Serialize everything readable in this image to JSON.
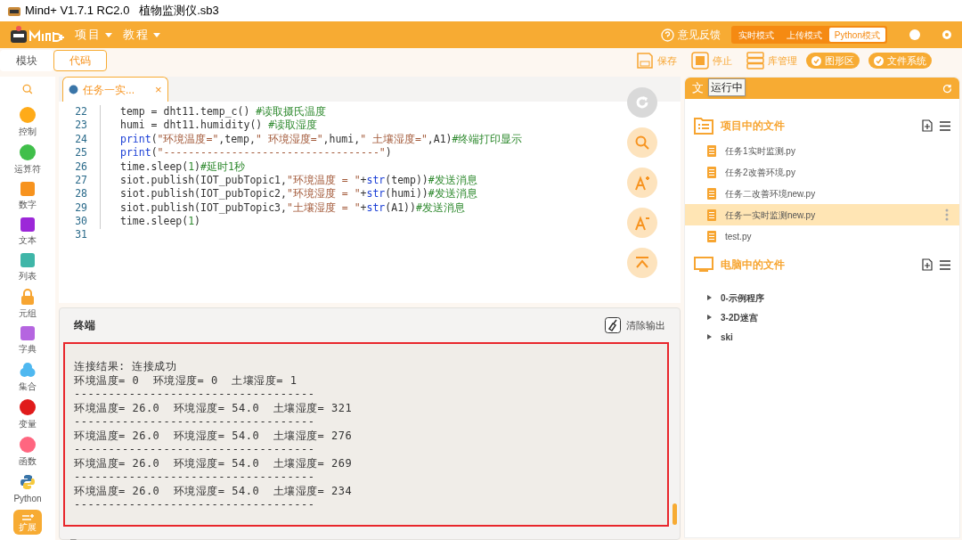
{
  "window": {
    "title": "Mind+ V1.7.1 RC2.0   植物监测仪.sb3"
  },
  "menu": [
    {
      "label": "项目"
    },
    {
      "label": "教程"
    }
  ],
  "header": {
    "feedback": "意见反馈",
    "modes": [
      {
        "label": "实时模式",
        "selected": false
      },
      {
        "label": "上传模式",
        "selected": false
      },
      {
        "label": "Python模式",
        "selected": true
      }
    ]
  },
  "view_tabs": [
    {
      "label": "模块",
      "selected": false
    },
    {
      "label": "代码",
      "selected": true
    }
  ],
  "toolbar": {
    "save": "保存",
    "stop": "停止",
    "library": "库管理",
    "toggles": [
      {
        "label": "图形区",
        "checked": true
      },
      {
        "label": "文件系统",
        "checked": true
      }
    ],
    "tooltip": "运行中"
  },
  "categories": [
    {
      "label": "控制",
      "kind": "dot",
      "color": "#ffab19"
    },
    {
      "label": "运算符",
      "kind": "dot",
      "color": "#40bf4a"
    },
    {
      "label": "数字",
      "kind": "tile",
      "color": "#f7931e"
    },
    {
      "label": "文本",
      "kind": "tile",
      "color": "#9c27d8"
    },
    {
      "label": "列表",
      "kind": "tile",
      "color": "#3fb6a8"
    },
    {
      "label": "元组",
      "kind": "lock",
      "color": "#f7a531"
    },
    {
      "label": "字典",
      "kind": "tile",
      "color": "#b565e0"
    },
    {
      "label": "集合",
      "kind": "blob",
      "color": "#4fb8f0"
    },
    {
      "label": "变量",
      "kind": "dot",
      "color": "#e01b1b"
    },
    {
      "label": "函数",
      "kind": "dot",
      "color": "#ff6680"
    },
    {
      "label": "Python",
      "kind": "python",
      "color": "#3a75a8"
    }
  ],
  "extension": {
    "label": "扩展"
  },
  "editor": {
    "tab": {
      "label": "任务一实...",
      "close": "×"
    },
    "lines": [
      {
        "no": "22",
        "tokens": [
          {
            "kind": "plain",
            "text": "temp = dht11.temp_c() "
          },
          {
            "kind": "comment",
            "text": "#读取摄氏温度"
          }
        ]
      },
      {
        "no": "23",
        "tokens": [
          {
            "kind": "plain",
            "text": "humi = dht11.humidity() "
          },
          {
            "kind": "comment",
            "text": "#读取湿度"
          }
        ]
      },
      {
        "no": "24",
        "tokens": [
          {
            "kind": "keyword",
            "text": "print"
          },
          {
            "kind": "plain",
            "text": "("
          },
          {
            "kind": "string",
            "text": "\"环境温度=\""
          },
          {
            "kind": "plain",
            "text": ",temp,"
          },
          {
            "kind": "string",
            "text": "\" 环境湿度=\""
          },
          {
            "kind": "plain",
            "text": ",humi,"
          },
          {
            "kind": "string",
            "text": "\" 土壤湿度=\""
          },
          {
            "kind": "plain",
            "text": ",A1)"
          },
          {
            "kind": "comment",
            "text": "#终端打印显示"
          }
        ]
      },
      {
        "no": "25",
        "tokens": [
          {
            "kind": "keyword",
            "text": "print"
          },
          {
            "kind": "plain",
            "text": "("
          },
          {
            "kind": "string",
            "text": "\"-----------------------------------\""
          },
          {
            "kind": "plain",
            "text": ")"
          }
        ]
      },
      {
        "no": "26",
        "tokens": [
          {
            "kind": "plain",
            "text": "time.sleep("
          },
          {
            "kind": "number",
            "text": "1"
          },
          {
            "kind": "plain",
            "text": ")"
          },
          {
            "kind": "comment",
            "text": "#延时1秒"
          }
        ]
      },
      {
        "no": "27",
        "tokens": [
          {
            "kind": "plain",
            "text": "siot.publish(IOT_pubTopic1,"
          },
          {
            "kind": "string",
            "text": "\"环境温度 = \""
          },
          {
            "kind": "plain",
            "text": "+"
          },
          {
            "kind": "keyword",
            "text": "str"
          },
          {
            "kind": "plain",
            "text": "(temp))"
          },
          {
            "kind": "comment",
            "text": "#发送消息"
          }
        ]
      },
      {
        "no": "28",
        "tokens": [
          {
            "kind": "plain",
            "text": "siot.publish(IOT_pubTopic2,"
          },
          {
            "kind": "string",
            "text": "\"环境湿度 = \""
          },
          {
            "kind": "plain",
            "text": "+"
          },
          {
            "kind": "keyword",
            "text": "str"
          },
          {
            "kind": "plain",
            "text": "(humi))"
          },
          {
            "kind": "comment",
            "text": "#发送消息"
          }
        ]
      },
      {
        "no": "29",
        "tokens": [
          {
            "kind": "plain",
            "text": "siot.publish(IOT_pubTopic3,"
          },
          {
            "kind": "string",
            "text": "\"土壤湿度 = \""
          },
          {
            "kind": "plain",
            "text": "+"
          },
          {
            "kind": "keyword",
            "text": "str"
          },
          {
            "kind": "plain",
            "text": "(A1))"
          },
          {
            "kind": "comment",
            "text": "#发送消息"
          }
        ]
      },
      {
        "no": "30",
        "tokens": [
          {
            "kind": "plain",
            "text": "time.sleep("
          },
          {
            "kind": "number",
            "text": "1"
          },
          {
            "kind": "plain",
            "text": ")"
          }
        ]
      },
      {
        "no": "31"
      }
    ]
  },
  "terminal": {
    "title": "终端",
    "clear": "清除输出",
    "output": [
      "连接结果: 连接成功",
      "环境温度= 0  环境湿度= 0  土壤湿度= 1",
      "-----------------------------------",
      "环境温度= 26.0  环境湿度= 54.0  土壤湿度= 321",
      "-----------------------------------",
      "环境温度= 26.0  环境湿度= 54.0  土壤湿度= 276",
      "-----------------------------------",
      "环境温度= 26.0  环境湿度= 54.0  土壤湿度= 269",
      "-----------------------------------",
      "环境温度= 26.0  环境湿度= 54.0  土壤湿度= 234",
      "-----------------------------------"
    ],
    "cursor": "_"
  },
  "file_panel": {
    "title": "文",
    "sections": [
      {
        "title": "项目中的文件",
        "kind": "project",
        "files": [
          {
            "name": "任务1实时监测.py",
            "selected": false
          },
          {
            "name": "任务2改善环境.py",
            "selected": false
          },
          {
            "name": "任务二改善环境new.py",
            "selected": false
          },
          {
            "name": "任务一实时监测new.py",
            "selected": true
          },
          {
            "name": "test.py",
            "selected": false
          }
        ]
      },
      {
        "title": "电脑中的文件",
        "kind": "computer",
        "folders": [
          {
            "name": "0-示例程序",
            "expanded": false
          },
          {
            "name": "3-2D迷宫",
            "expanded": false
          },
          {
            "name": "ski",
            "expanded": false
          }
        ]
      }
    ]
  }
}
